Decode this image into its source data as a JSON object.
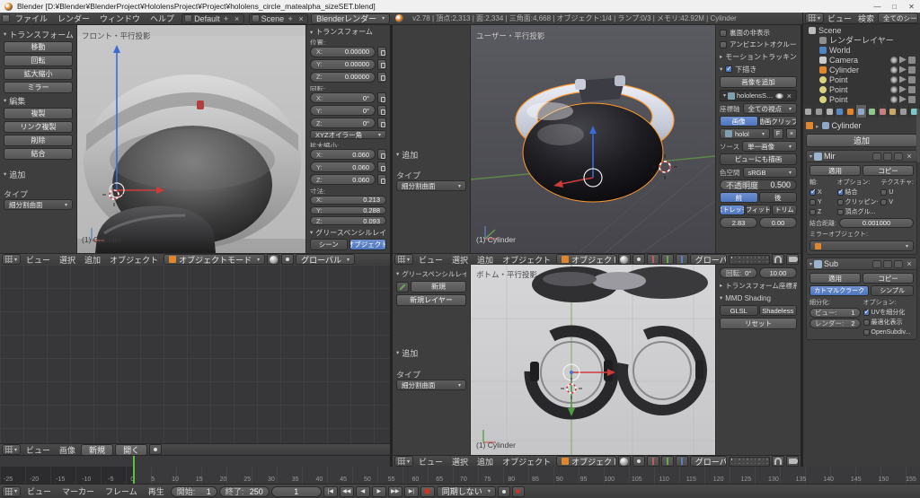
{
  "titlebar": {
    "title": "Blender [D:¥Blender¥BlenderProject¥HololensProject¥Project¥hololens_circle_matealpha_sizeSET.blend]",
    "minimize": "—",
    "maximize": "□",
    "close": "✕"
  },
  "infobar": {
    "menus": [
      "ファイル",
      "レンダー",
      "ウィンドウ",
      "ヘルプ"
    ],
    "layout": "Default",
    "scene": "Scene",
    "engine": "Blenderレンダー",
    "stats": "v2.78 | 頂点:2,313 | 面:2,334 | 三角面:4,668 | オブジェクト:1/4 | ランプ:0/3 | メモリ:42.92M | Cylinder"
  },
  "left_shelf": {
    "transform_label": "トランスフォーム",
    "move": "移動",
    "rotate": "回転",
    "scale": "拡大縮小",
    "mirror": "ミラー",
    "edit_label": "編集",
    "duplicate": "複製",
    "linked_duplicate": "リンク複製",
    "delete": "削除",
    "join": "結合",
    "add_label": "追加",
    "type_label": "タイプ",
    "type_value": "細分割曲面"
  },
  "front_view": {
    "label": "フロント・平行投影",
    "object": "(1) Cylinder"
  },
  "npanel_front": {
    "panel_label": "トランスフォーム",
    "location_label": "位置:",
    "loc_x_label": "X:",
    "loc_x": "0.00000",
    "loc_y_label": "Y:",
    "loc_y": "0.00000",
    "loc_z_label": "Z:",
    "loc_z": "0.00000",
    "rotation_label": "回転:",
    "rot_x_label": "X:",
    "rot_x": "0°",
    "rot_y_label": "Y:",
    "rot_y": "0°",
    "rot_z_label": "Z:",
    "rot_z": "0°",
    "rotation_mode": "XYZオイラー角",
    "scale_label": "拡大縮小:",
    "scl_x_label": "X:",
    "scl_x": "0.060",
    "scl_y_label": "Y:",
    "scl_y": "0.060",
    "scl_z_label": "Z:",
    "scl_z": "0.060",
    "dim_label": "寸法:",
    "dim_x_label": "X:",
    "dim_x": "0.213",
    "dim_y_label": "Y:",
    "dim_y": "0.288",
    "dim_z_label": "Z:",
    "dim_z": "0.093",
    "gp_label": "グリースペンシルレイヤ",
    "gp_scene": "シーン",
    "gp_object": "オブジェクト"
  },
  "view_header": {
    "menus": [
      "ビュー",
      "選択",
      "追加",
      "オブジェクト"
    ],
    "mode": "オブジェクトモード",
    "orientation": "グローバル"
  },
  "mid_shelf_top": {
    "add_label": "追加",
    "type_label": "タイプ",
    "type_value": "細分割曲面"
  },
  "user_view": {
    "label": "ユーザー・平行投影",
    "object": "(1) Cylinder"
  },
  "npanel_user": {
    "backface": "裏面の非表示",
    "ao": "アンビエントオクルージョン(AO)",
    "motion_tracking": "モーショントラッキング",
    "bg_label": "下描き",
    "add_image": "画像を追加",
    "image_item": "hololensSA...",
    "axis_label": "座標軸",
    "axis_value": "全ての視点",
    "toggle_image": "画像",
    "toggle_movie": "動画クリップ",
    "datablock": "holol",
    "fake_user": "F",
    "source_label": "ソース",
    "source_value": "単一画像",
    "draw_view": "ビューにも描画",
    "colorspace_label": "色空間",
    "colorspace_value": "sRGB",
    "opacity_label": "不透明度",
    "opacity_value": "0.500",
    "front": "前",
    "back": "後",
    "stretch": "ストレッチ",
    "fit": "フィット",
    "crop": "トリム",
    "size_value": "2.83",
    "offset_value": "0.00"
  },
  "uv_editor": {
    "menus": [
      "ビュー",
      "画像"
    ],
    "new_button": "新規",
    "open_button": "開く"
  },
  "bottom_view": {
    "label": "ボトム・平行投影",
    "object": "(1) Cylinder"
  },
  "mid_shelf_bottom": {
    "gp_label": "グリースペンシルレイヤー",
    "new_button": "新規",
    "new_layer_button": "新規レイヤー",
    "add_label": "追加",
    "type_label": "タイプ",
    "type_value": "細分割曲面"
  },
  "npanel_bottom": {
    "rotation_label": "回転:",
    "rotation_value": "0°",
    "size_value": "10.00",
    "orientation_panel": "トランスフォーム座標系",
    "mmd_label": "MMD Shading",
    "glsl": "GLSL",
    "shadeless": "Shadeless",
    "reset": "リセット"
  },
  "outliner": {
    "menus": [
      "ビュー",
      "検索"
    ],
    "display": "全てのシーン",
    "items": [
      {
        "label": "Scene",
        "depth": 0,
        "type": "scene",
        "toggles": false
      },
      {
        "label": "レンダーレイヤー",
        "depth": 1,
        "type": "renderlayer",
        "toggles": false
      },
      {
        "label": "World",
        "depth": 1,
        "type": "world",
        "toggles": false
      },
      {
        "label": "Camera",
        "depth": 1,
        "type": "camera",
        "toggles": true
      },
      {
        "label": "Cylinder",
        "depth": 1,
        "type": "mesh",
        "toggles": true
      },
      {
        "label": "Point",
        "depth": 1,
        "type": "lamp",
        "toggles": true
      },
      {
        "label": "Point",
        "depth": 1,
        "type": "lamp",
        "toggles": true
      },
      {
        "label": "Point",
        "depth": 1,
        "type": "lamp",
        "toggles": true
      }
    ]
  },
  "properties": {
    "tabs": [
      {
        "name": "render",
        "color": "#a8a8a8",
        "active": false
      },
      {
        "name": "render-layers",
        "color": "#9a9a9a",
        "active": false
      },
      {
        "name": "scene",
        "color": "#b5b5b5",
        "active": false
      },
      {
        "name": "world",
        "color": "#5b87c4",
        "active": false
      },
      {
        "name": "object",
        "color": "#e0872d",
        "active": false
      },
      {
        "name": "modifiers",
        "color": "#8fa8c8",
        "active": true
      },
      {
        "name": "object-data",
        "color": "#8fc88f",
        "active": false
      },
      {
        "name": "material",
        "color": "#c87f7f",
        "active": false
      },
      {
        "name": "texture",
        "color": "#c8a86a",
        "active": false
      },
      {
        "name": "particles",
        "color": "#9a9a9a",
        "active": false
      },
      {
        "name": "physics",
        "color": "#7fc8c8",
        "active": false
      }
    ],
    "breadcrumb": "Cylinder",
    "add_modifier": "追加",
    "mirror": {
      "name": "Mir",
      "apply": "適用",
      "copy": "コピー",
      "axis_label": "軸:",
      "axis_x": "X",
      "axis_y": "Y",
      "axis_z": "Z",
      "options_label": "オプション:",
      "opt_merge": "結合",
      "opt_clipping": "クリッピング",
      "opt_vgroups": "頂点グル...",
      "tex_label": "テクスチャ:",
      "tex_u": "U",
      "tex_v": "V",
      "merge_label": "結合距離:",
      "merge_value": "0.001000",
      "mirror_obj_label": "ミラーオブジェクト:"
    },
    "subsurf": {
      "name": "Sub",
      "apply": "適用",
      "copy": "コピー",
      "catmull": "カトマルクラーク",
      "simple": "シンプル",
      "subd_label": "細分化:",
      "view_label": "ビュー:",
      "view_value": "1",
      "render_label": "レンダー:",
      "render_value": "2",
      "options_label": "オプション:",
      "opt_uv": "UVを細分化",
      "opt_optimal": "最適化表示",
      "opt_osd": "OpenSubdiv..."
    }
  },
  "timeline": {
    "labels": [
      "-25",
      "-20",
      "-15",
      "-10",
      "-5",
      "0",
      "5",
      "10",
      "15",
      "20",
      "25",
      "30",
      "35",
      "40",
      "45",
      "50",
      "55",
      "60",
      "65",
      "70",
      "75",
      "80",
      "85",
      "90",
      "95",
      "100",
      "105",
      "110",
      "115",
      "120",
      "125",
      "130",
      "135",
      "140",
      "145",
      "150",
      "155"
    ],
    "menus": [
      "ビュー",
      "マーカー",
      "フレーム",
      "再生"
    ],
    "start_label": "開始:",
    "start_value": "1",
    "end_label": "終了:",
    "end_value": "250",
    "current": "1",
    "playback": [
      "|◀",
      "◀◀",
      "◀",
      "▶",
      "▶▶",
      "▶|"
    ],
    "sync": "同期しない"
  }
}
